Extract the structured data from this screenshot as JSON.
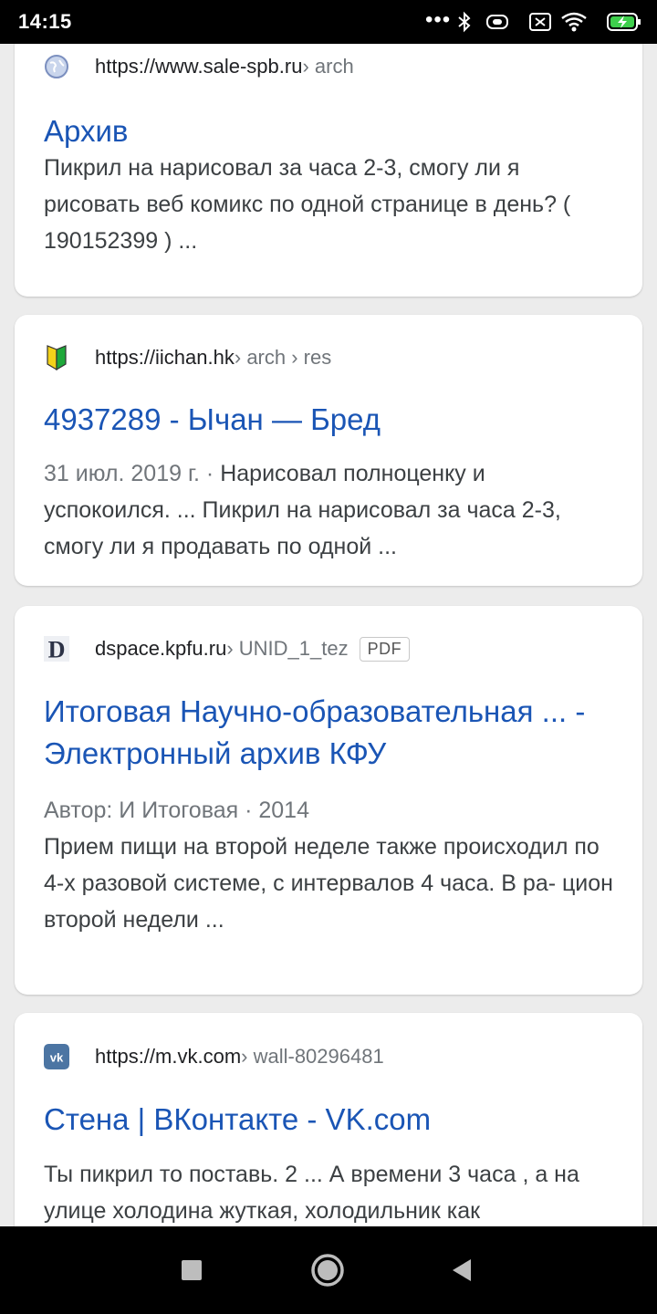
{
  "status_bar": {
    "time": "14:15",
    "more_icon": "three-dots",
    "icons": [
      "bluetooth-icon",
      "vibrate-icon",
      "no-sim-icon",
      "wifi-icon",
      "battery-charging-icon"
    ]
  },
  "results": [
    {
      "favicon": "globe-icon",
      "url": "https://www.sale-spb.ru",
      "path": " › arch",
      "title": "Архив",
      "meta": "",
      "snippet": "Пикрил на нарисовал за часа 2-3, смогу ли я рисовать веб комикс по одной странице в день? ( 190152399 ) ..."
    },
    {
      "favicon": "beginner-leaf-icon",
      "url": "https://iichan.hk",
      "path": " › arch › res",
      "title": "4937289 - Ычан — Бред",
      "meta": "31 июл. 2019 г. · ",
      "snippet": "Нарисовал полноценку и успокоился. ... Пикрил на нарисовал за часа 2-3, смогу ли я продавать по одной ..."
    },
    {
      "favicon": "dspace-d-icon",
      "url": "dspace.kpfu.ru",
      "path": " › UNID_1_tez",
      "badge": "PDF",
      "title": "Итоговая Научно-образовательная ... - Электронный архив КФУ",
      "meta": "Автор: И Итоговая · 2014",
      "snippet": "Прием пищи на второй неделе также происходил по 4-х разовой системе, с интервалов 4 часа. В ра- цион второй недели ..."
    },
    {
      "favicon": "vk-icon",
      "url": "https://m.vk.com",
      "path": " › wall-80296481",
      "title": "Стена | ВКонтакте - VK.com",
      "meta": "",
      "snippet": "Ты пикрил то поставь. 2 ... А времени 3 часа , а на улице холодина жуткая, холодильник как"
    }
  ],
  "nav_bar": {
    "recents": "recents-square-icon",
    "home": "home-circle-icon",
    "back": "back-triangle-icon"
  }
}
